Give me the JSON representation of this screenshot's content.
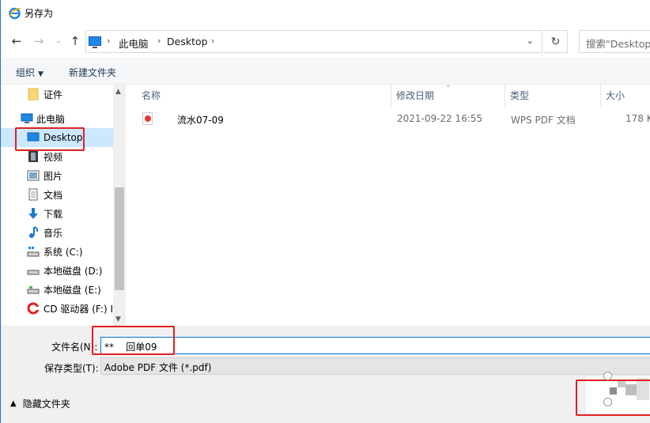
{
  "window": {
    "title": "另存为",
    "accent_color": "#0078d7",
    "annotation_color": "#e02020"
  },
  "nav": {
    "back_icon": "arrow-left-icon",
    "forward_icon": "arrow-right-icon",
    "recent_icon": "chevron-down-icon",
    "up_icon": "arrow-up-icon",
    "breadcrumb": [
      "此电脑",
      "Desktop"
    ],
    "search_placeholder": "搜索\"Desktop\""
  },
  "commands": {
    "organize": "组织",
    "new_folder": "新建文件夹"
  },
  "sidebar": {
    "items": [
      {
        "label": "证件",
        "icon": "folder-icon"
      },
      {
        "label": "此电脑",
        "icon": "computer-icon"
      },
      {
        "label": "Desktop",
        "icon": "desktop-icon",
        "selected": true
      },
      {
        "label": "视频",
        "icon": "video-icon"
      },
      {
        "label": "图片",
        "icon": "pictures-icon"
      },
      {
        "label": "文档",
        "icon": "documents-icon"
      },
      {
        "label": "下载",
        "icon": "download-icon"
      },
      {
        "label": "音乐",
        "icon": "music-icon"
      },
      {
        "label": "系统 (C:)",
        "icon": "system-drive-icon"
      },
      {
        "label": "本地磁盘 (D:)",
        "icon": "drive-icon"
      },
      {
        "label": "本地磁盘 (E:)",
        "icon": "drive-icon"
      },
      {
        "label": "CD 驱动器 (F:) I",
        "icon": "cd-drive-icon"
      }
    ]
  },
  "filelist": {
    "columns": [
      "名称",
      "修改日期",
      "类型",
      "大小"
    ],
    "files": [
      {
        "name": "流水07-09",
        "modified": "2021-09-22 16:55",
        "type": "WPS PDF 文档",
        "size": "178 K",
        "icon": "pdf-file-icon"
      }
    ]
  },
  "form": {
    "filename_label": "文件名(N):",
    "filename_value": "**    回单09",
    "filetype_label": "保存类型(T):",
    "filetype_value": "Adobe PDF 文件 (*.pdf)",
    "hide_folders": "隐藏文件夹"
  }
}
